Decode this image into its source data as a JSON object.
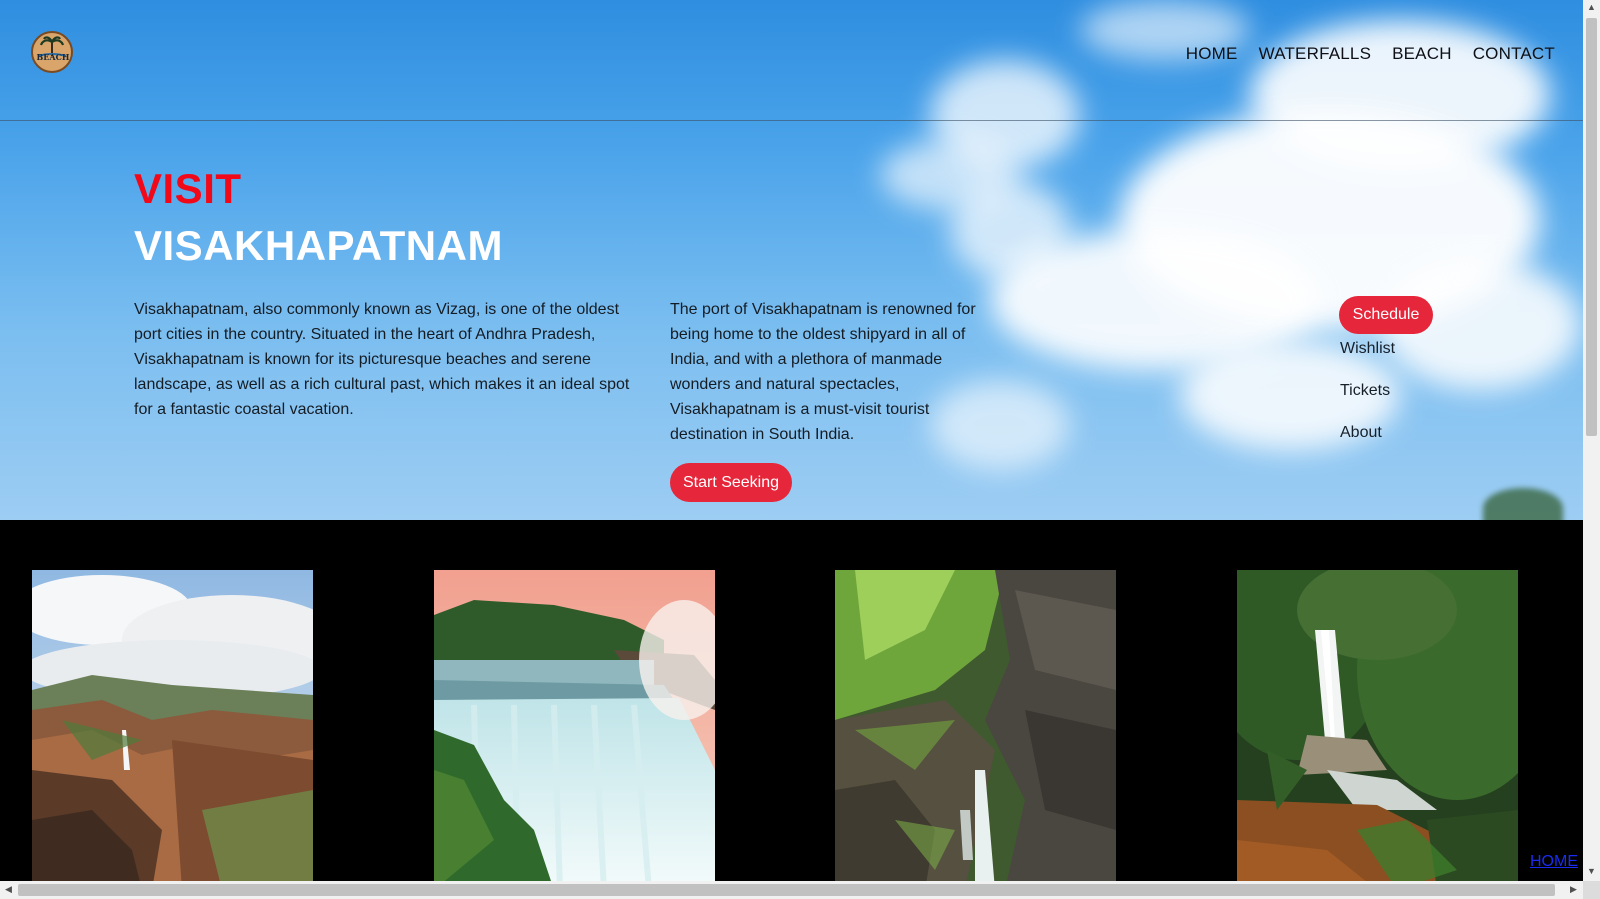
{
  "brand": {
    "logo_text": "BEACH"
  },
  "nav": {
    "items": [
      {
        "label": "HOME"
      },
      {
        "label": "WATERFALLS"
      },
      {
        "label": "BEACH"
      },
      {
        "label": "CONTACT"
      }
    ]
  },
  "hero": {
    "title_line1": "VISIT",
    "title_line2": "VISAKHAPATNAM",
    "paragraph1": "Visakhapatnam, also commonly known as Vizag, is one of the oldest port cities in the country. Situated in the heart of Andhra Pradesh, Visakhapatnam is known for its picturesque beaches and serene landscape, as well as a rich cultural past, which makes it an ideal spot for a fantastic coastal vacation.",
    "paragraph2": "The port of Visakhapatnam is renowned for being home to the oldest shipyard in all of India, and with a plethora of manmade wonders and natural spectacles, Visakhapatnam is a must-visit tourist destination in South India.",
    "cta_label": "Start Seeking"
  },
  "side_menu": {
    "schedule_label": "Schedule",
    "links": [
      {
        "label": "Wishlist"
      },
      {
        "label": "Tickets"
      },
      {
        "label": "About"
      }
    ]
  },
  "gallery": {
    "photos": [
      {
        "icon": "canyon-waterfall-photo"
      },
      {
        "icon": "niagara-falls-photo"
      },
      {
        "icon": "gorge-cascade-photo"
      },
      {
        "icon": "forest-waterfall-photo"
      }
    ]
  },
  "footer_link": {
    "label": "HOME"
  },
  "colors": {
    "accent_red": "#f1091a",
    "button_red": "#e6263a",
    "link_blue": "#1a2cf0"
  }
}
